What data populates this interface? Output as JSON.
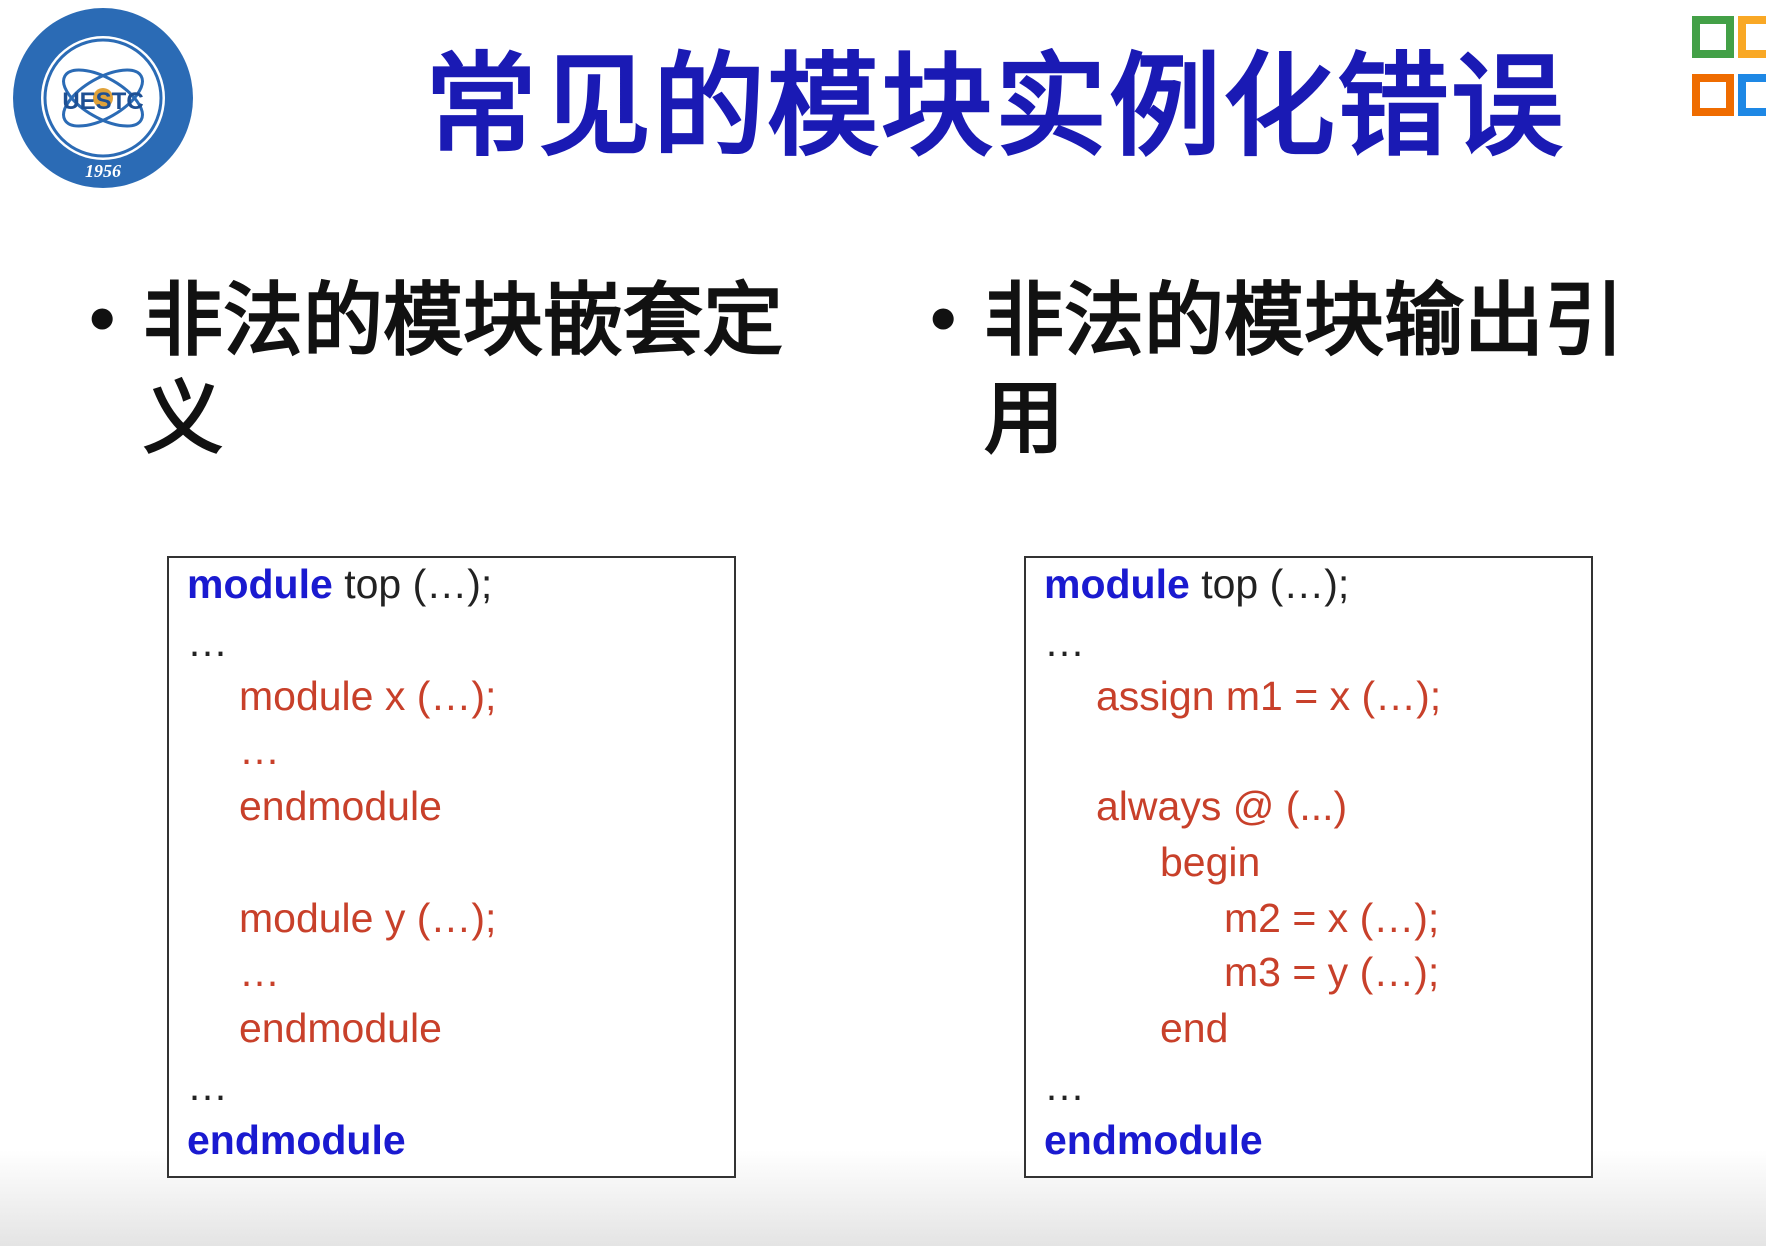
{
  "logo": {
    "label": "UESTC",
    "year": "1956"
  },
  "title": "常见的模块实例化错误",
  "bullets": {
    "left": {
      "line1": "非法的模块嵌套定",
      "line2": "义"
    },
    "right": {
      "line1": "非法的模块输出引",
      "line2": "用"
    }
  },
  "left_code": {
    "l1_kw": "module",
    "l1_rest": " top (…);",
    "l2": "…",
    "l3": "module x (…);",
    "l4": "…",
    "l5": "endmodule",
    "l6": "module y (…);",
    "l7": "…",
    "l8": "endmodule",
    "l9": "…",
    "l10": "endmodule"
  },
  "right_code": {
    "l1_kw": "module",
    "l1_rest": " top (…);",
    "l2": "…",
    "l3": "assign m1 = x (…);",
    "l4": "always @ (...)",
    "l5": "begin",
    "l6": "m2 = x (…);",
    "l7": "m3 = y (…);",
    "l8": "end",
    "l9": "…",
    "l10": "endmodule"
  },
  "colors": {
    "title": "#1a1ab4",
    "keyword": "#1a1ad0",
    "code_red": "#c8402a",
    "logo_blue": "#1d5fa8"
  },
  "icons": {
    "logo": "university-seal-icon",
    "corner": "stacked-squares-logo-icon"
  }
}
